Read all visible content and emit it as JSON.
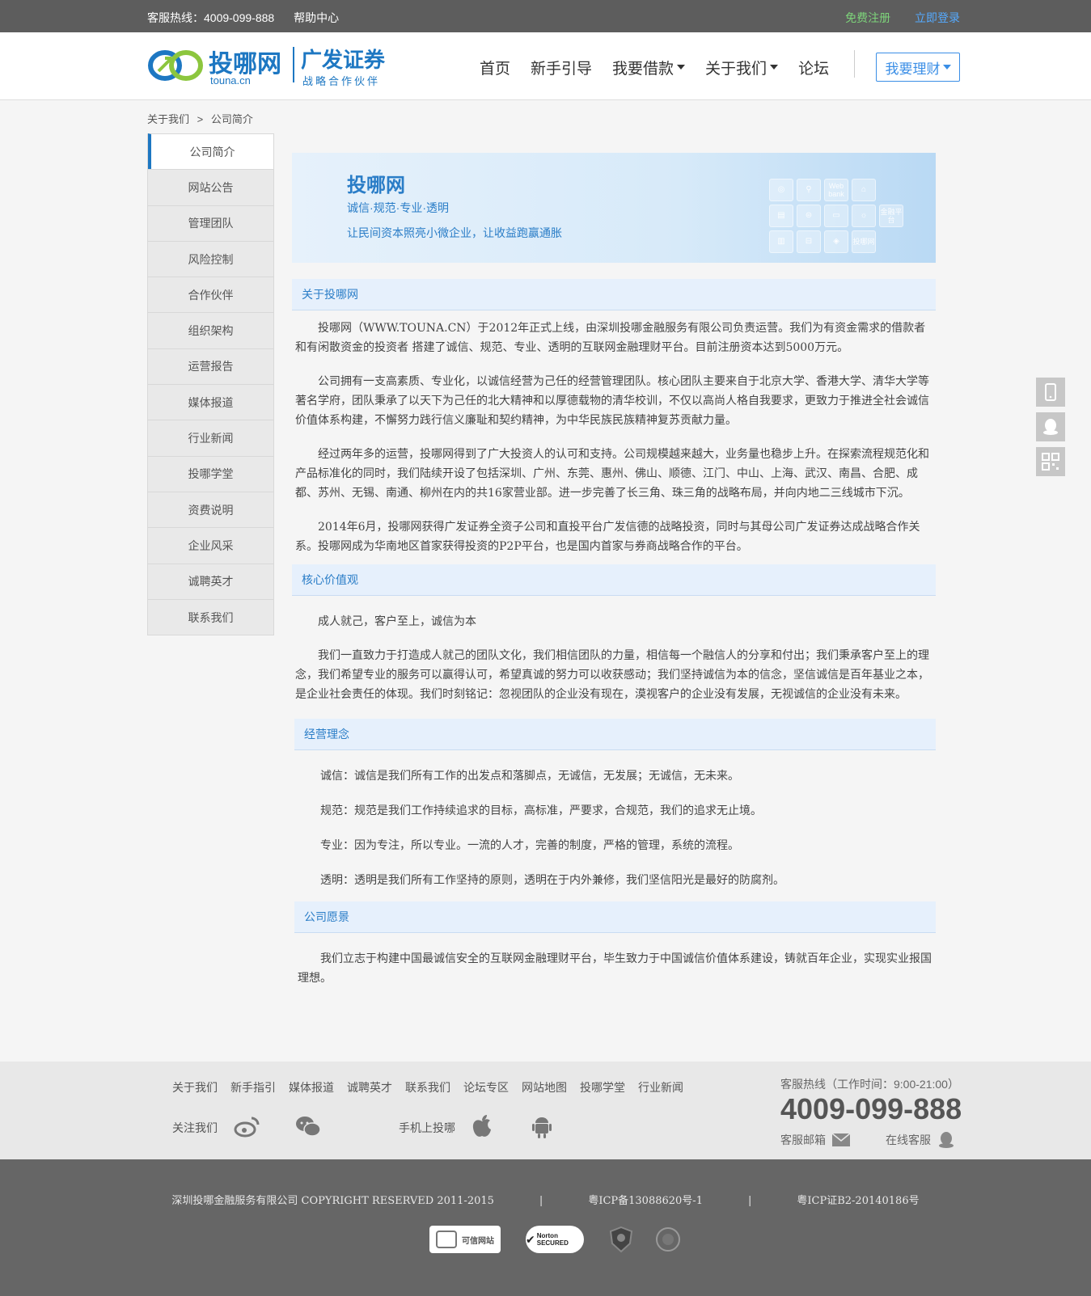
{
  "topbar": {
    "hotline_label": "客服热线：4009-099-888",
    "help": "帮助中心",
    "register": "免费注册",
    "login": "立即登录"
  },
  "header": {
    "logo_brand": "投哪网",
    "logo_domain": "touna.cn",
    "partner_name": "广发证券",
    "partner_sub": "战略合作伙伴",
    "nav": [
      "首页",
      "新手引导",
      "我要借款",
      "关于我们",
      "论坛"
    ],
    "invest_button": "我要理财"
  },
  "breadcrumb": {
    "parent": "关于我们",
    "sep": ">",
    "current": "公司简介"
  },
  "sidebar": {
    "items": [
      "公司简介",
      "网站公告",
      "管理团队",
      "风险控制",
      "合作伙伴",
      "组织架构",
      "运营报告",
      "媒体报道",
      "行业新闻",
      "投哪学堂",
      "资费说明",
      "企业风采",
      "诚聘英才",
      "联系我们"
    ]
  },
  "banner": {
    "title": "投哪网",
    "subtitle": "诚信·规范·专业·透明",
    "slogan": "让民间资本照亮小微企业，让收益跑赢通胀",
    "tiles": [
      "Web bank",
      "金融平台",
      "投哪网"
    ]
  },
  "sections": {
    "about": {
      "heading": "关于投哪网",
      "paragraphs": [
        "投哪网（WWW.TOUNA.CN）于2012年正式上线，由深圳投哪金融服务有限公司负责运营。我们为有资金需求的借款者和有闲散资金的投资者 搭建了诚信、规范、专业、透明的互联网金融理财平台。目前注册资本达到5000万元。",
        "公司拥有一支高素质、专业化，以诚信经营为己任的经营管理团队。核心团队主要来自于北京大学、香港大学、清华大学等著名学府，团队秉承了以天下为己任的北大精神和以厚德载物的清华校训，不仅以高尚人格自我要求，更致力于推进全社会诚信价值体系构建，不懈努力践行信义廉耻和契约精神，为中华民族民族精神复苏贡献力量。",
        "经过两年多的运营，投哪网得到了广大投资人的认可和支持。公司规模越来越大，业务量也稳步上升。在探索流程规范化和产品标准化的同时，我们陆续开设了包括深圳、广州、东莞、惠州、佛山、顺德、江门、中山、上海、武汉、南昌、合肥、成都、苏州、无锡、南通、柳州在内的共16家营业部。进一步完善了长三角、珠三角的战略布局，并向内地二三线城市下沉。",
        "2014年6月，投哪网获得广发证券全资子公司和直投平台广发信德的战略投资，同时与其母公司广发证券达成战略合作关系。投哪网成为华南地区首家获得投资的P2P平台，也是国内首家与券商战略合作的平台。"
      ]
    },
    "values": {
      "heading": "核心价值观",
      "paragraphs": [
        "成人就己，客户至上，诚信为本",
        "我们一直致力于打造成人就己的团队文化，我们相信团队的力量，相信每一个融信人的分享和付出；我们秉承客户至上的理念，我们希望专业的服务可以赢得认可，希望真诚的努力可以收获感动；我们坚持诚信为本的信念，坚信诚信是百年基业之本，是企业社会责任的体现。我们时刻铭记：忽视团队的企业没有现在，漠视客户的企业没有发展，无视诚信的企业没有未来。"
      ]
    },
    "philosophy": {
      "heading": "经营理念",
      "paragraphs": [
        "诚信：诚信是我们所有工作的出发点和落脚点，无诚信，无发展；无诚信，无未来。",
        "规范：规范是我们工作持续追求的目标，高标准，严要求，合规范，我们的追求无止境。",
        "专业：因为专注，所以专业。一流的人才，完善的制度，严格的管理，系统的流程。",
        "透明：透明是我们所有工作坚持的原则，透明在于内外兼修，我们坚信阳光是最好的防腐剂。"
      ]
    },
    "vision": {
      "heading": "公司愿景",
      "paragraphs": [
        "我们立志于构建中国最诚信安全的互联网金融理财平台，毕生致力于中国诚信价值体系建设，铸就百年企业，实现实业报国理想。"
      ]
    }
  },
  "footer": {
    "links": [
      "关于我们",
      "新手指引",
      "媒体报道",
      "诚聘英才",
      "联系我们",
      "论坛专区",
      "网站地图",
      "投哪学堂",
      "行业新闻"
    ],
    "follow_label": "关注我们",
    "mobile_label": "手机上投哪",
    "hotline_label": "客服热线（工作时间：9:00-21:00）",
    "hotline": "4009-099-888",
    "mail_label": "客服邮箱",
    "online_label": "在线客服"
  },
  "copyright": {
    "company": "深圳投哪金融服务有限公司 COPYRIGHT RESERVED 2011-2015",
    "icp1": "粤ICP备13088620号-1",
    "icp2": "粤ICP证B2-20140186号",
    "divider": "|",
    "badges": [
      "可信网站",
      "Norton SECURED"
    ]
  },
  "colors": {
    "accent": "#1d77c2",
    "topbar_bg": "#5d5d5d",
    "register": "#7dd37a",
    "login": "#55aaff",
    "section_bg": "#e6f0fc"
  },
  "icons": [
    "phone-icon",
    "qq-icon",
    "qrcode-icon",
    "weibo-icon",
    "wechat-icon",
    "apple-icon",
    "android-icon",
    "mail-icon",
    "service-icon"
  ]
}
